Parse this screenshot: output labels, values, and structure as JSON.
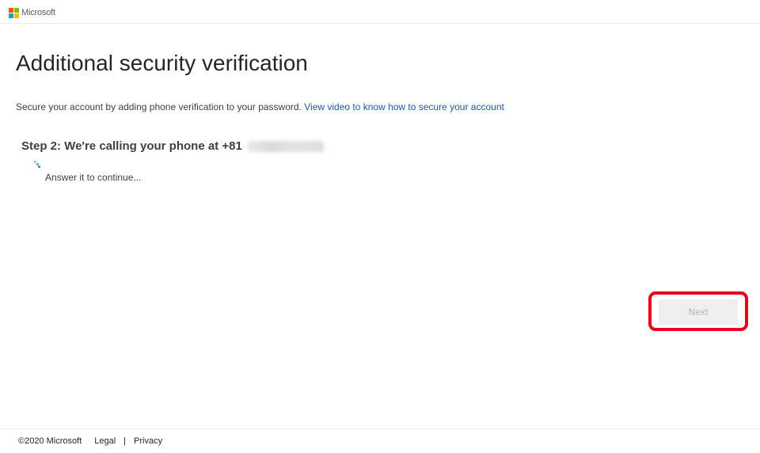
{
  "header": {
    "brand": "Microsoft",
    "logo_colors": [
      "#f25022",
      "#7fba00",
      "#00a4ef",
      "#ffb900"
    ]
  },
  "main": {
    "title": "Additional security verification",
    "description": "Secure your account by adding phone verification to your password.",
    "video_link": "View video to know how to secure your account",
    "step_text": "Step 2: We're calling your phone at +81",
    "status_text": "Answer it to continue...",
    "next_label": "Next"
  },
  "footer": {
    "copyright": "©2020 Microsoft",
    "legal": "Legal",
    "separator": "|",
    "privacy": "Privacy"
  },
  "colors": {
    "link": "#1e5aa0",
    "highlight": "#e8001c",
    "spinner": "#2f8fc4"
  }
}
